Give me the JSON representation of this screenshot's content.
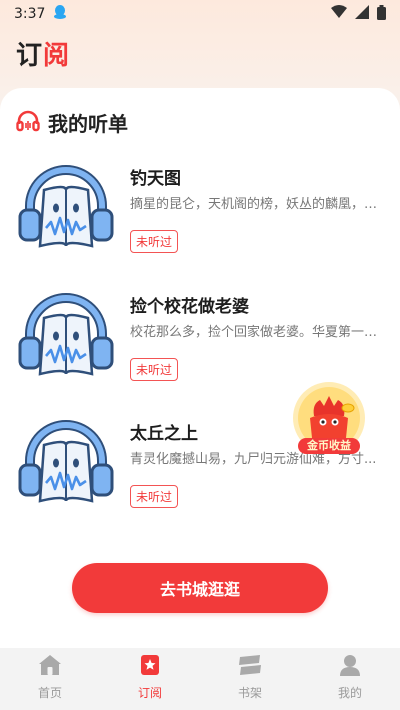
{
  "status_bar": {
    "time": "3:37"
  },
  "header": {
    "title_part1": "订",
    "title_part2": "阅"
  },
  "section": {
    "title": "我的听单"
  },
  "items": [
    {
      "title": "钓天图",
      "desc": "摘星的昆仑，天机阁的榜，妖丛的麟凰，日...",
      "badge": "未听过"
    },
    {
      "title": "捡个校花做老婆",
      "desc": "校花那么多，捡个回家做老婆。华夏第一战...",
      "badge": "未听过"
    },
    {
      "title": "太丘之上",
      "desc": "青灵化魔撼山易，九尸归元游仙难，方寸...",
      "badge": "未听过"
    }
  ],
  "floating": {
    "label": "金币收益"
  },
  "cta": {
    "label": "去书城逛逛"
  },
  "nav": {
    "items": [
      {
        "label": "首页",
        "icon": "home-icon"
      },
      {
        "label": "订阅",
        "icon": "subscribe-icon"
      },
      {
        "label": "书架",
        "icon": "bookshelf-icon"
      },
      {
        "label": "我的",
        "icon": "profile-icon"
      }
    ],
    "active_index": 1
  },
  "colors": {
    "accent": "#f23a3a",
    "inactive": "#9a9a9a",
    "headphone_blue": "#6ea8f0"
  }
}
